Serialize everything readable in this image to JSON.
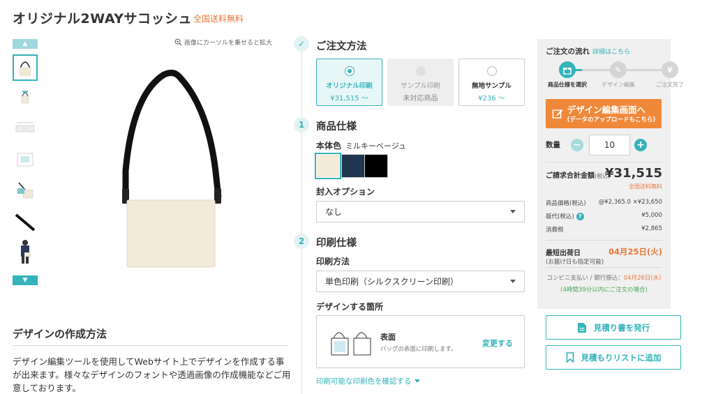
{
  "header": {
    "title": "オリジナル2WAYサコッシュ",
    "shipping_badge": "全国送料無料"
  },
  "gallery": {
    "zoom_hint": "画像にカーソルを乗せると拡大",
    "thumbnail_count": 7
  },
  "howto": {
    "title": "デザインの作成方法",
    "text": "デザイン編集ツールを使用してWebサイト上でデザインを作成する事が出来ます。様々なデザインのフォントや透過画像の作成機能などご用意しております。"
  },
  "order_method": {
    "title": "ご注文方法",
    "options": [
      {
        "label": "オリジナル印刷",
        "sub": "¥31,515 〜"
      },
      {
        "label": "サンプル印刷",
        "sub": "未対応商品"
      },
      {
        "label": "無地サンプル",
        "sub": "¥236 〜"
      }
    ]
  },
  "product_spec": {
    "step": "1",
    "title": "商品仕様",
    "body_color_label": "本体色",
    "body_color_value": "ミルキーベージュ",
    "swatches": [
      "#f3ead8",
      "#1f3550",
      "#000000"
    ],
    "enclosure_label": "封入オプション",
    "enclosure_value": "なし"
  },
  "print_spec": {
    "step": "2",
    "title": "印刷仕様",
    "method_label": "印刷方法",
    "method_value": "単色印刷（シルクスクリーン印刷）",
    "placement_label": "デザインする箇所",
    "placement_title": "表面",
    "placement_desc": "バッグの表面に印刷します。",
    "change_label": "変更する",
    "print_colors_link": "印刷可能な印刷色を確認する"
  },
  "summary": {
    "flow_title": "ご注文の流れ",
    "flow_link": "詳細はこちら",
    "flow_steps": [
      "商品仕様を選択",
      "デザイン編集",
      "ご注文完了"
    ],
    "design_button_main": "デザイン編集画面へ",
    "design_button_sub": "(データのアップロードもこちら)",
    "qty_label": "数量",
    "qty_value": "10",
    "total_label": "ご請求合計金額",
    "total_tax": "(税込)",
    "total_value": "¥31,515",
    "total_shipping": "全国送料無料",
    "rows": [
      {
        "label": "商品価格",
        "label_tax": "(税込)",
        "value": "@¥2,365.0 ×¥23,650"
      },
      {
        "label": "版代",
        "label_tax": "(税込)",
        "value": "¥5,000"
      },
      {
        "label": "消費税",
        "label_tax": "",
        "value": "¥2,865"
      }
    ],
    "ship_label": "最短出荷日",
    "ship_sub": "(お届け日も指定可能)",
    "ship_date": "04月25日(火)",
    "pay_note_prefix": "コンビニ支払い / 銀行振込：",
    "pay_note_date": "04月26日(水)",
    "pay_note2": "(4時間39分以内にご注文の場合)"
  },
  "actions": {
    "estimate_button": "見積り書を発行",
    "estimate_list_button": "見積もりリストに追加"
  },
  "colors": {
    "accent": "#34b3b8",
    "orange": "#f0883a",
    "price_orange": "#e8783a"
  }
}
